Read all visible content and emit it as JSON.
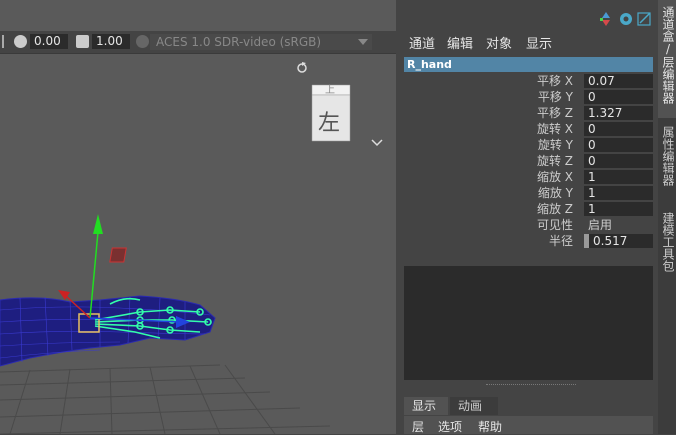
{
  "viewport": {
    "toolbar": {
      "field1": "0.00",
      "field2": "1.00",
      "color_space": "ACES 1.0 SDR-video (sRGB)"
    },
    "viewcube_label": "左",
    "viewcube_top_label": "上"
  },
  "channel_box": {
    "menus": [
      "通道",
      "编辑",
      "对象",
      "显示"
    ],
    "node_name": "R_hand",
    "attributes": [
      {
        "label": "平移 X",
        "value": "0.07"
      },
      {
        "label": "平移 Y",
        "value": "0"
      },
      {
        "label": "平移 Z",
        "value": "1.327"
      },
      {
        "label": "旋转 X",
        "value": "0"
      },
      {
        "label": "旋转 Y",
        "value": "0"
      },
      {
        "label": "旋转 Z",
        "value": "0"
      },
      {
        "label": "缩放 X",
        "value": "1"
      },
      {
        "label": "缩放 Y",
        "value": "1"
      },
      {
        "label": "缩放 Z",
        "value": "1"
      },
      {
        "label": "可见性",
        "value": "启用"
      },
      {
        "label": "半径",
        "value": "0.517"
      }
    ],
    "bottom_tabs": [
      "显示",
      "动画"
    ],
    "layer_menu": [
      "层",
      "选项",
      "帮助"
    ]
  },
  "sidebar": {
    "tabs": [
      "通道盒/层编辑器",
      "属性编辑器",
      "建模工具包"
    ]
  },
  "colors": {
    "selection": "#5285a6",
    "viewport_bg": "#5a5a5a",
    "mesh": "#1a1a8c",
    "joint_highlight": "#33ffaa"
  }
}
